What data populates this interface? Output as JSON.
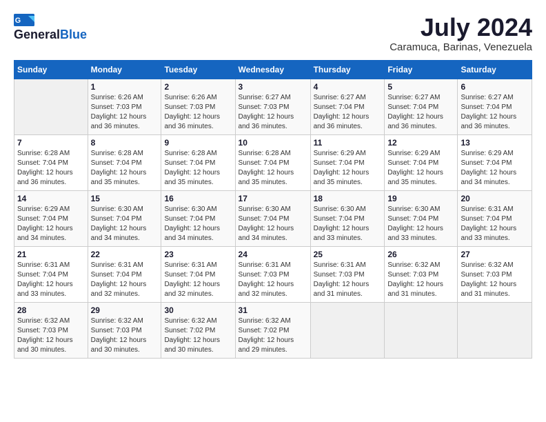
{
  "header": {
    "logo_general": "General",
    "logo_blue": "Blue",
    "month_year": "July 2024",
    "location": "Caramuca, Barinas, Venezuela"
  },
  "calendar": {
    "days_of_week": [
      "Sunday",
      "Monday",
      "Tuesday",
      "Wednesday",
      "Thursday",
      "Friday",
      "Saturday"
    ],
    "weeks": [
      [
        {
          "day": "",
          "sunrise": "",
          "sunset": "",
          "daylight": ""
        },
        {
          "day": "1",
          "sunrise": "Sunrise: 6:26 AM",
          "sunset": "Sunset: 7:03 PM",
          "daylight": "Daylight: 12 hours and 36 minutes."
        },
        {
          "day": "2",
          "sunrise": "Sunrise: 6:26 AM",
          "sunset": "Sunset: 7:03 PM",
          "daylight": "Daylight: 12 hours and 36 minutes."
        },
        {
          "day": "3",
          "sunrise": "Sunrise: 6:27 AM",
          "sunset": "Sunset: 7:03 PM",
          "daylight": "Daylight: 12 hours and 36 minutes."
        },
        {
          "day": "4",
          "sunrise": "Sunrise: 6:27 AM",
          "sunset": "Sunset: 7:04 PM",
          "daylight": "Daylight: 12 hours and 36 minutes."
        },
        {
          "day": "5",
          "sunrise": "Sunrise: 6:27 AM",
          "sunset": "Sunset: 7:04 PM",
          "daylight": "Daylight: 12 hours and 36 minutes."
        },
        {
          "day": "6",
          "sunrise": "Sunrise: 6:27 AM",
          "sunset": "Sunset: 7:04 PM",
          "daylight": "Daylight: 12 hours and 36 minutes."
        }
      ],
      [
        {
          "day": "7",
          "sunrise": "Sunrise: 6:28 AM",
          "sunset": "Sunset: 7:04 PM",
          "daylight": "Daylight: 12 hours and 36 minutes."
        },
        {
          "day": "8",
          "sunrise": "Sunrise: 6:28 AM",
          "sunset": "Sunset: 7:04 PM",
          "daylight": "Daylight: 12 hours and 35 minutes."
        },
        {
          "day": "9",
          "sunrise": "Sunrise: 6:28 AM",
          "sunset": "Sunset: 7:04 PM",
          "daylight": "Daylight: 12 hours and 35 minutes."
        },
        {
          "day": "10",
          "sunrise": "Sunrise: 6:28 AM",
          "sunset": "Sunset: 7:04 PM",
          "daylight": "Daylight: 12 hours and 35 minutes."
        },
        {
          "day": "11",
          "sunrise": "Sunrise: 6:29 AM",
          "sunset": "Sunset: 7:04 PM",
          "daylight": "Daylight: 12 hours and 35 minutes."
        },
        {
          "day": "12",
          "sunrise": "Sunrise: 6:29 AM",
          "sunset": "Sunset: 7:04 PM",
          "daylight": "Daylight: 12 hours and 35 minutes."
        },
        {
          "day": "13",
          "sunrise": "Sunrise: 6:29 AM",
          "sunset": "Sunset: 7:04 PM",
          "daylight": "Daylight: 12 hours and 34 minutes."
        }
      ],
      [
        {
          "day": "14",
          "sunrise": "Sunrise: 6:29 AM",
          "sunset": "Sunset: 7:04 PM",
          "daylight": "Daylight: 12 hours and 34 minutes."
        },
        {
          "day": "15",
          "sunrise": "Sunrise: 6:30 AM",
          "sunset": "Sunset: 7:04 PM",
          "daylight": "Daylight: 12 hours and 34 minutes."
        },
        {
          "day": "16",
          "sunrise": "Sunrise: 6:30 AM",
          "sunset": "Sunset: 7:04 PM",
          "daylight": "Daylight: 12 hours and 34 minutes."
        },
        {
          "day": "17",
          "sunrise": "Sunrise: 6:30 AM",
          "sunset": "Sunset: 7:04 PM",
          "daylight": "Daylight: 12 hours and 34 minutes."
        },
        {
          "day": "18",
          "sunrise": "Sunrise: 6:30 AM",
          "sunset": "Sunset: 7:04 PM",
          "daylight": "Daylight: 12 hours and 33 minutes."
        },
        {
          "day": "19",
          "sunrise": "Sunrise: 6:30 AM",
          "sunset": "Sunset: 7:04 PM",
          "daylight": "Daylight: 12 hours and 33 minutes."
        },
        {
          "day": "20",
          "sunrise": "Sunrise: 6:31 AM",
          "sunset": "Sunset: 7:04 PM",
          "daylight": "Daylight: 12 hours and 33 minutes."
        }
      ],
      [
        {
          "day": "21",
          "sunrise": "Sunrise: 6:31 AM",
          "sunset": "Sunset: 7:04 PM",
          "daylight": "Daylight: 12 hours and 33 minutes."
        },
        {
          "day": "22",
          "sunrise": "Sunrise: 6:31 AM",
          "sunset": "Sunset: 7:04 PM",
          "daylight": "Daylight: 12 hours and 32 minutes."
        },
        {
          "day": "23",
          "sunrise": "Sunrise: 6:31 AM",
          "sunset": "Sunset: 7:04 PM",
          "daylight": "Daylight: 12 hours and 32 minutes."
        },
        {
          "day": "24",
          "sunrise": "Sunrise: 6:31 AM",
          "sunset": "Sunset: 7:03 PM",
          "daylight": "Daylight: 12 hours and 32 minutes."
        },
        {
          "day": "25",
          "sunrise": "Sunrise: 6:31 AM",
          "sunset": "Sunset: 7:03 PM",
          "daylight": "Daylight: 12 hours and 31 minutes."
        },
        {
          "day": "26",
          "sunrise": "Sunrise: 6:32 AM",
          "sunset": "Sunset: 7:03 PM",
          "daylight": "Daylight: 12 hours and 31 minutes."
        },
        {
          "day": "27",
          "sunrise": "Sunrise: 6:32 AM",
          "sunset": "Sunset: 7:03 PM",
          "daylight": "Daylight: 12 hours and 31 minutes."
        }
      ],
      [
        {
          "day": "28",
          "sunrise": "Sunrise: 6:32 AM",
          "sunset": "Sunset: 7:03 PM",
          "daylight": "Daylight: 12 hours and 30 minutes."
        },
        {
          "day": "29",
          "sunrise": "Sunrise: 6:32 AM",
          "sunset": "Sunset: 7:03 PM",
          "daylight": "Daylight: 12 hours and 30 minutes."
        },
        {
          "day": "30",
          "sunrise": "Sunrise: 6:32 AM",
          "sunset": "Sunset: 7:02 PM",
          "daylight": "Daylight: 12 hours and 30 minutes."
        },
        {
          "day": "31",
          "sunrise": "Sunrise: 6:32 AM",
          "sunset": "Sunset: 7:02 PM",
          "daylight": "Daylight: 12 hours and 29 minutes."
        },
        {
          "day": "",
          "sunrise": "",
          "sunset": "",
          "daylight": ""
        },
        {
          "day": "",
          "sunrise": "",
          "sunset": "",
          "daylight": ""
        },
        {
          "day": "",
          "sunrise": "",
          "sunset": "",
          "daylight": ""
        }
      ]
    ]
  }
}
